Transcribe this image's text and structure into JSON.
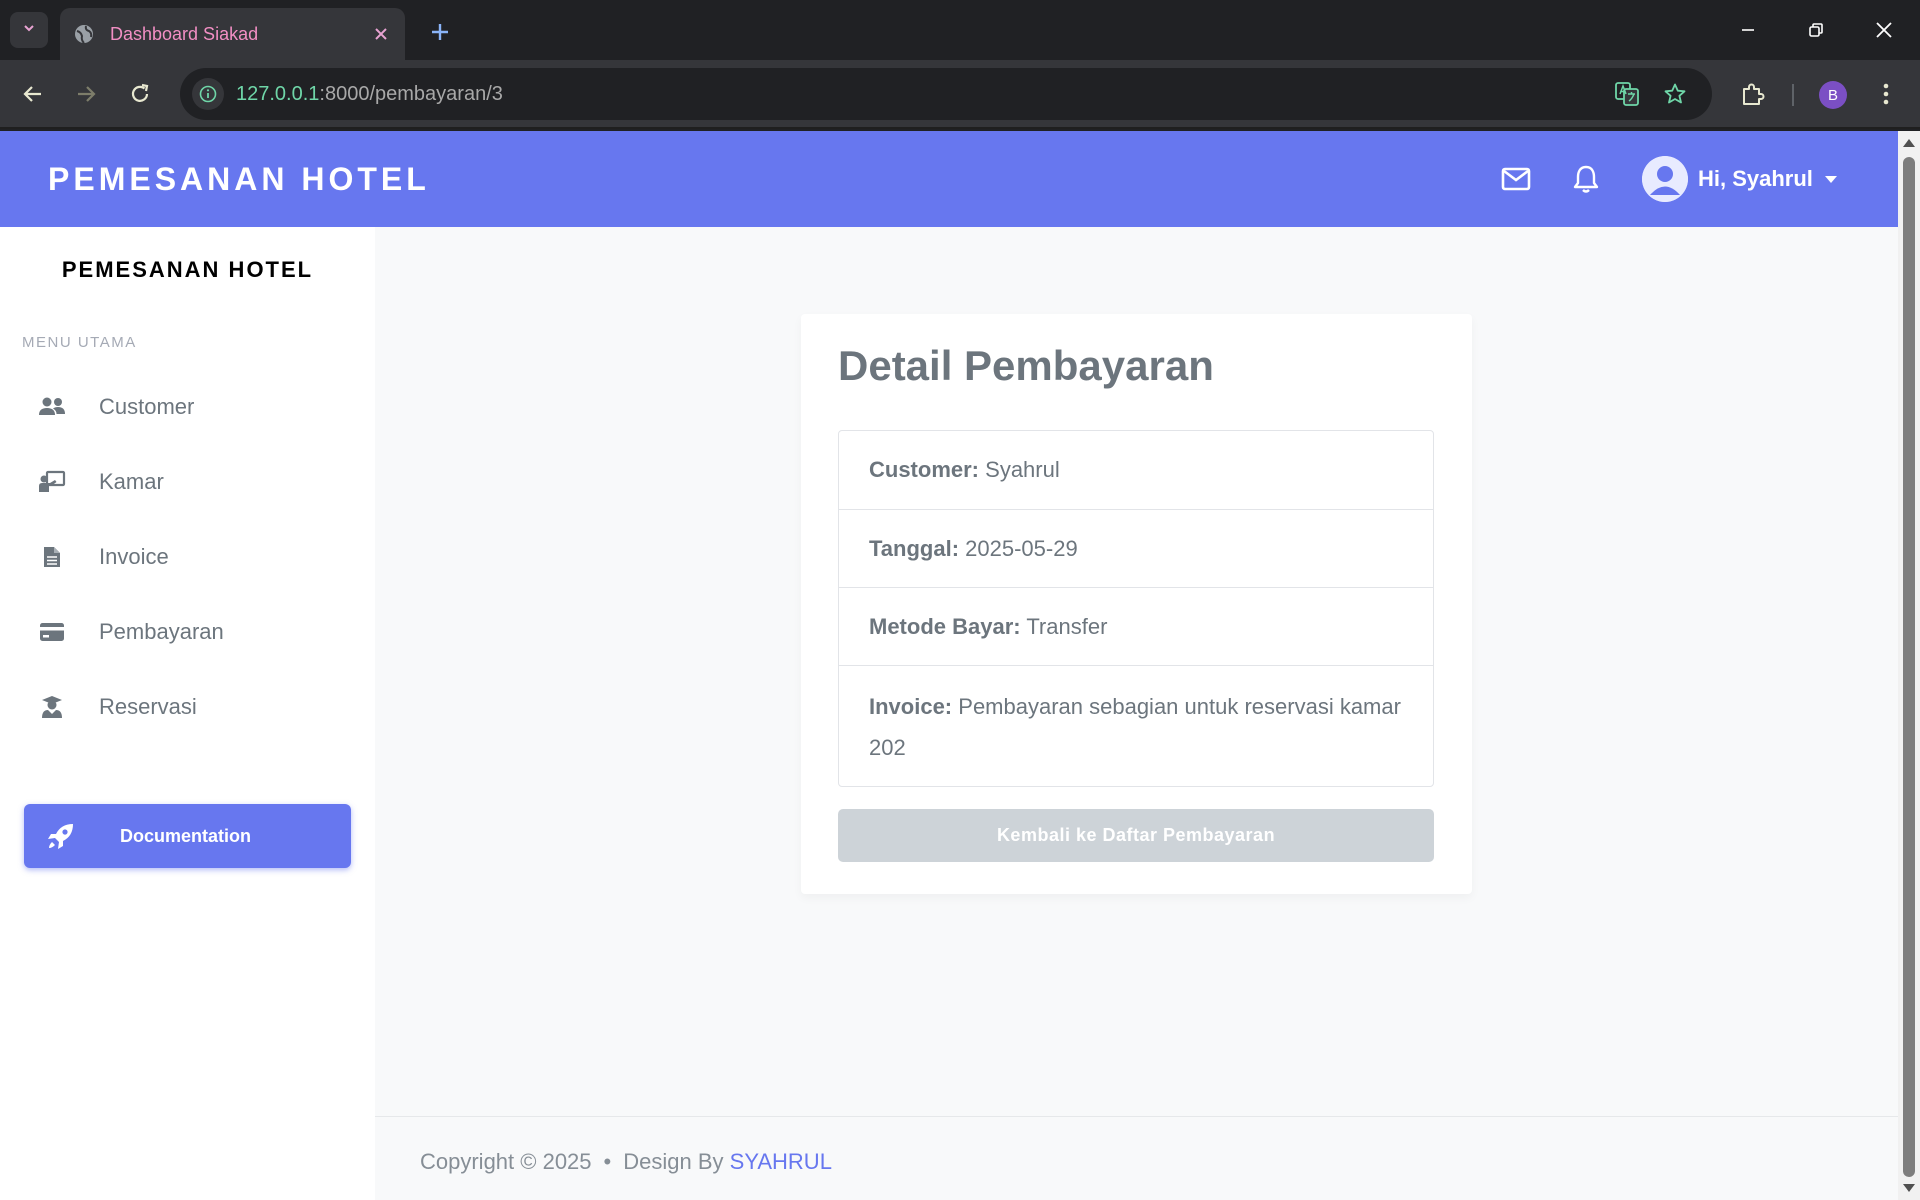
{
  "browser": {
    "tab_title": "Dashboard Siakad",
    "url_host": "127.0.0.1",
    "url_path": ":8000/pembayaran/3",
    "profile_initial": "B"
  },
  "header": {
    "brand": "PEMESANAN HOTEL",
    "greeting": "Hi, Syahrul"
  },
  "sidebar": {
    "brand": "PEMESANAN HOTEL",
    "section_header": "MENU UTAMA",
    "items": [
      {
        "label": "Customer",
        "icon": "users-icon"
      },
      {
        "label": "Kamar",
        "icon": "chalkboard-teacher-icon"
      },
      {
        "label": "Invoice",
        "icon": "file-alt-icon"
      },
      {
        "label": "Pembayaran",
        "icon": "credit-card-icon"
      },
      {
        "label": "Reservasi",
        "icon": "user-graduate-icon"
      }
    ],
    "doc_button": "Documentation"
  },
  "detail": {
    "title": "Detail Pembayaran",
    "rows": [
      {
        "label": "Customer:",
        "value": "Syahrul"
      },
      {
        "label": "Tanggal:",
        "value": "2025-05-29"
      },
      {
        "label": "Metode Bayar:",
        "value": "Transfer"
      },
      {
        "label": "Invoice:",
        "value": "Pembayaran sebagian untuk reservasi kamar 202"
      }
    ],
    "back_button": "Kembali ke Daftar Pembayaran"
  },
  "footer": {
    "copyright": "Copyright © 2025",
    "separator": "•",
    "design_by": "Design By",
    "author": "SYAHRUL"
  },
  "colors": {
    "primary": "#6777ef",
    "muted_text": "#6c757d",
    "page_bg": "#f8f9fa"
  }
}
